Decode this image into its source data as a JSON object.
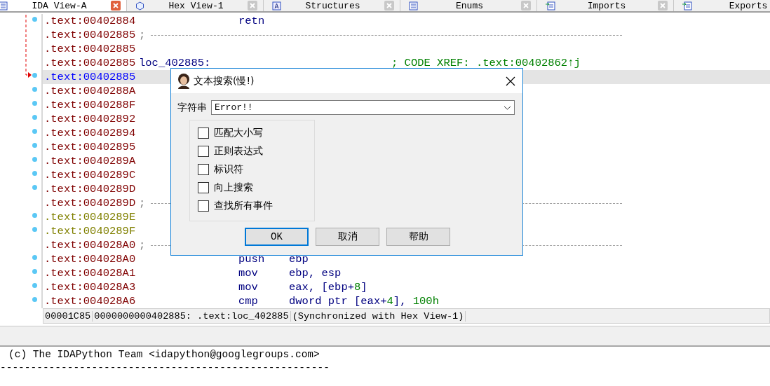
{
  "tabs": [
    {
      "label": "IDA View-A",
      "selected": true
    },
    {
      "label": "Hex View-1",
      "selected": false
    },
    {
      "label": "Structures",
      "selected": false
    },
    {
      "label": "Enums",
      "selected": false
    },
    {
      "label": "Imports",
      "selected": false
    },
    {
      "label": "Exports",
      "selected": false
    }
  ],
  "listing": {
    "rows": [
      {
        "address": ".text:00402884",
        "kind": "instruction",
        "data_item": false,
        "selected": false,
        "dot": true,
        "mnemonic": "retn"
      },
      {
        "address": ".text:00402885",
        "kind": "separator",
        "data_item": false,
        "selected": false,
        "dot": false,
        "mark": ";"
      },
      {
        "address": ".text:00402885",
        "kind": "blank",
        "data_item": false,
        "selected": false,
        "dot": false
      },
      {
        "address": ".text:00402885",
        "kind": "label",
        "data_item": false,
        "selected": false,
        "dot": false,
        "label": "loc_402885:",
        "comment": "; CODE XREF: .text:00402862↑j"
      },
      {
        "address": ".text:00402885",
        "kind": "instruction",
        "selected": true,
        "dot": true
      },
      {
        "address": ".text:0040288A",
        "kind": "instruction",
        "data_item": false,
        "selected": false,
        "dot": true
      },
      {
        "address": ".text:0040288F",
        "kind": "instruction",
        "data_item": false,
        "selected": false,
        "dot": true
      },
      {
        "address": ".text:00402892",
        "kind": "instruction",
        "data_item": false,
        "selected": false,
        "dot": true
      },
      {
        "address": ".text:00402894",
        "kind": "instruction",
        "data_item": false,
        "selected": false,
        "dot": true
      },
      {
        "address": ".text:00402895",
        "kind": "instruction",
        "data_item": false,
        "selected": false,
        "dot": true
      },
      {
        "address": ".text:0040289A",
        "kind": "instruction",
        "data_item": false,
        "selected": false,
        "dot": true
      },
      {
        "address": ".text:0040289C",
        "kind": "instruction",
        "data_item": false,
        "selected": false,
        "dot": true
      },
      {
        "address": ".text:0040289D",
        "kind": "instruction",
        "data_item": false,
        "selected": false,
        "dot": true
      },
      {
        "address": ".text:0040289D",
        "kind": "separator",
        "data_item": false,
        "selected": false,
        "dot": false,
        "mark": ";"
      },
      {
        "address": ".text:0040289E",
        "kind": "instruction",
        "data_item": true,
        "selected": false,
        "dot": true
      },
      {
        "address": ".text:0040289F",
        "kind": "instruction",
        "data_item": true,
        "selected": false,
        "dot": true
      },
      {
        "address": ".text:004028A0",
        "kind": "separator",
        "data_item": false,
        "selected": false,
        "dot": false,
        "mark": ";"
      },
      {
        "address": ".text:004028A0",
        "kind": "instruction",
        "data_item": false,
        "selected": false,
        "dot": true,
        "mnemonic": "push",
        "operand": [
          {
            "text": "ebp",
            "kind": "register"
          }
        ]
      },
      {
        "address": ".text:004028A1",
        "kind": "instruction",
        "data_item": false,
        "selected": false,
        "dot": true,
        "mnemonic": "mov",
        "operand": [
          {
            "text": "ebp, esp",
            "kind": "register"
          }
        ]
      },
      {
        "address": ".text:004028A3",
        "kind": "instruction",
        "data_item": false,
        "selected": false,
        "dot": true,
        "mnemonic": "mov",
        "operand": [
          {
            "text": "eax, [ebp+",
            "kind": "register"
          },
          {
            "text": "8",
            "kind": "number"
          },
          {
            "text": "]",
            "kind": "register"
          }
        ]
      },
      {
        "address": ".text:004028A6",
        "kind": "instruction",
        "data_item": false,
        "selected": false,
        "dot": true,
        "mnemonic": "cmp",
        "operand": [
          {
            "text": "dword ptr [eax+",
            "kind": "register"
          },
          {
            "text": "4",
            "kind": "number"
          },
          {
            "text": "], ",
            "kind": "register"
          },
          {
            "text": "100h",
            "kind": "number"
          }
        ]
      }
    ]
  },
  "status_bar": [
    "00001C85",
    "0000000000402885: .text:loc_402885",
    "(Synchronized with Hex View-1)"
  ],
  "output": [
    "(c) The IDAPython Team <idapython@googlegroups.com>",
    "------------------------------------------------------"
  ],
  "dialog": {
    "title": "文本搜索(慢!)",
    "field_label": "字符串",
    "value": "Error!!",
    "options": [
      {
        "label": "匹配大小写",
        "checked": false
      },
      {
        "label": "正则表达式",
        "checked": false
      },
      {
        "label": "标识符",
        "checked": false
      },
      {
        "label": "向上搜索",
        "checked": false
      },
      {
        "label": "查找所有事件",
        "checked": false
      }
    ],
    "buttons": [
      {
        "label": "OK",
        "default": true
      },
      {
        "label": "取消",
        "default": false
      },
      {
        "label": "帮助",
        "default": false
      }
    ]
  }
}
